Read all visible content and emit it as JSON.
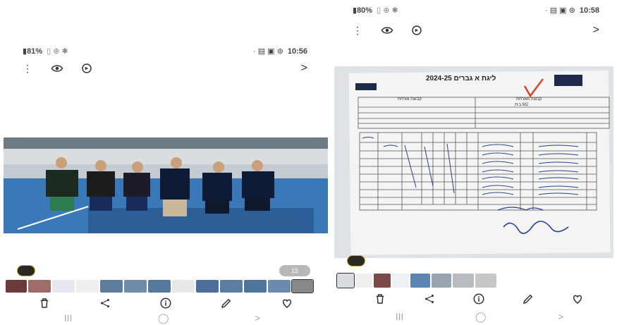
{
  "left": {
    "status": {
      "battery": "81%",
      "time": "10:56"
    },
    "photo_count": "15",
    "navbar": {
      "recent": "III",
      "home": "◯",
      "back": ">"
    }
  },
  "right": {
    "status": {
      "battery": "80%",
      "time": "10:58"
    },
    "navbar": {
      "recent": "III",
      "home": "◯",
      "back": ">"
    },
    "sheet": {
      "title": "ליגת א גברים 2024-25",
      "team_label_left": "קבוצה אורחת",
      "team_label_right": "קבוצה מארחת",
      "team_right_name": "M2 בית"
    }
  },
  "colors": {
    "accent": "#c9a72e",
    "floor": "#3a79b8",
    "shirt": "#0d1b36"
  }
}
